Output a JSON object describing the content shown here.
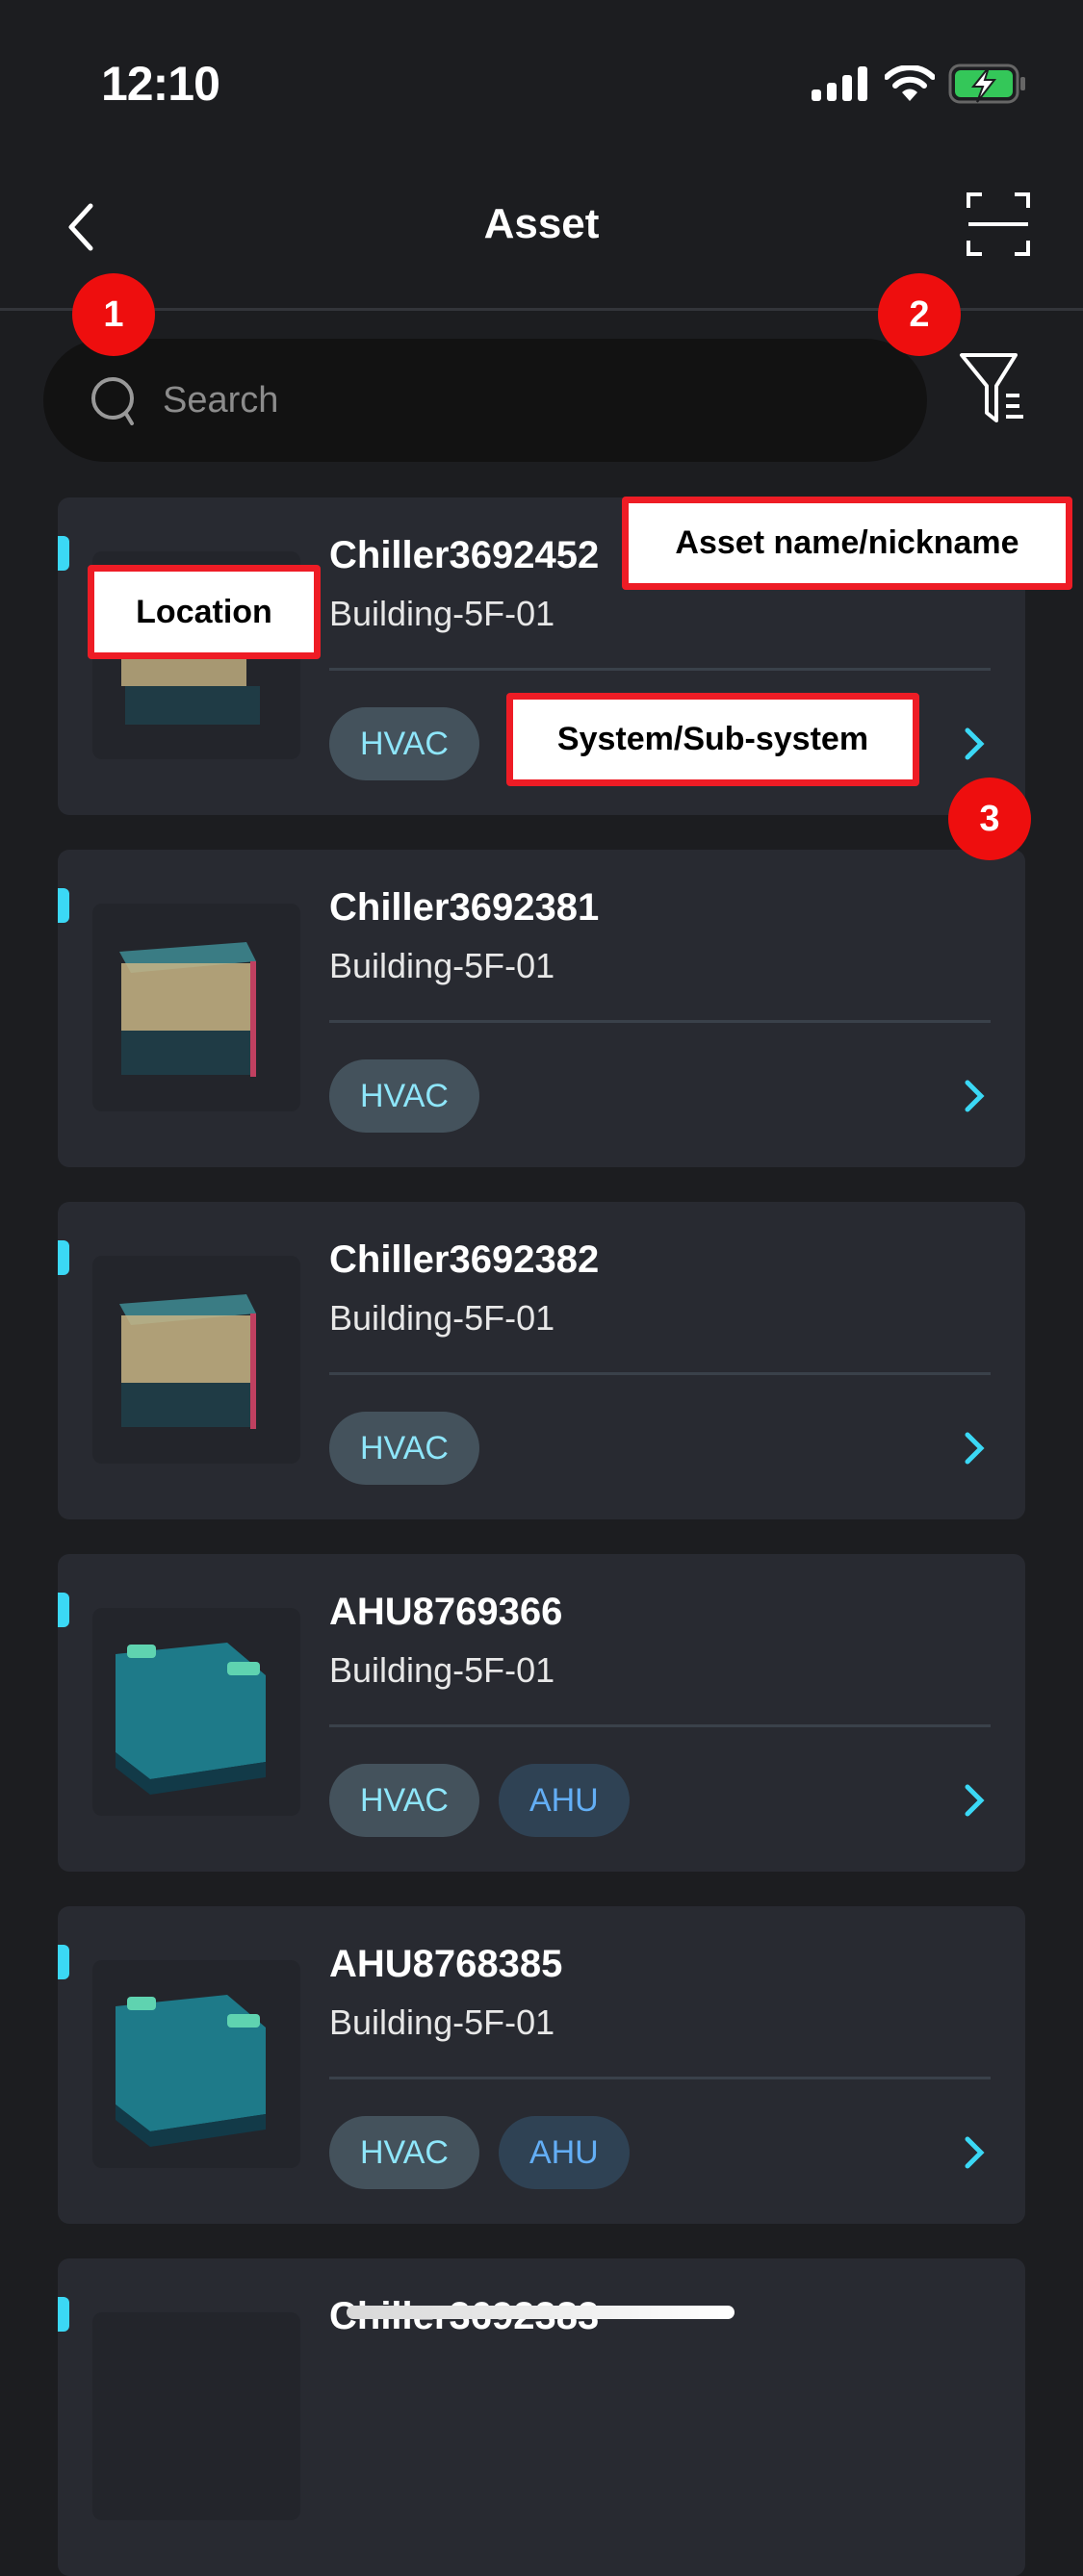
{
  "status_bar": {
    "time": "12:10",
    "icons": [
      "signal-icon",
      "wifi-icon",
      "battery-charging-icon"
    ],
    "battery_color": "#34c759"
  },
  "nav": {
    "title": "Asset",
    "back_icon": "chevron-left-icon",
    "scan_icon": "scan-icon"
  },
  "search": {
    "placeholder": "Search",
    "value": "",
    "icon": "search-icon"
  },
  "filter": {
    "icon": "filter-icon"
  },
  "colors": {
    "accent": "#3bd8f5",
    "annotation_red": "#ee1c25",
    "card_bg": "#282a31",
    "page_bg": "#1c1d20"
  },
  "assets": [
    {
      "name": "Chiller3692452",
      "location": "Building-5F-01",
      "tags": [
        "HVAC"
      ],
      "type": "chiller"
    },
    {
      "name": "Chiller3692381",
      "location": "Building-5F-01",
      "tags": [
        "HVAC"
      ],
      "type": "chiller"
    },
    {
      "name": "Chiller3692382",
      "location": "Building-5F-01",
      "tags": [
        "HVAC"
      ],
      "type": "chiller"
    },
    {
      "name": "AHU8769366",
      "location": "Building-5F-01",
      "tags": [
        "HVAC",
        "AHU"
      ],
      "type": "ahu"
    },
    {
      "name": "AHU8768385",
      "location": "Building-5F-01",
      "tags": [
        "HVAC",
        "AHU"
      ],
      "type": "ahu"
    },
    {
      "name": "Chiller3692383",
      "location": "",
      "tags": [],
      "type": "chiller"
    }
  ],
  "annotations": {
    "badges": [
      "1",
      "2",
      "3"
    ],
    "labels": {
      "name": "Asset name/nickname",
      "location": "Location",
      "system": "System/Sub-system"
    }
  }
}
